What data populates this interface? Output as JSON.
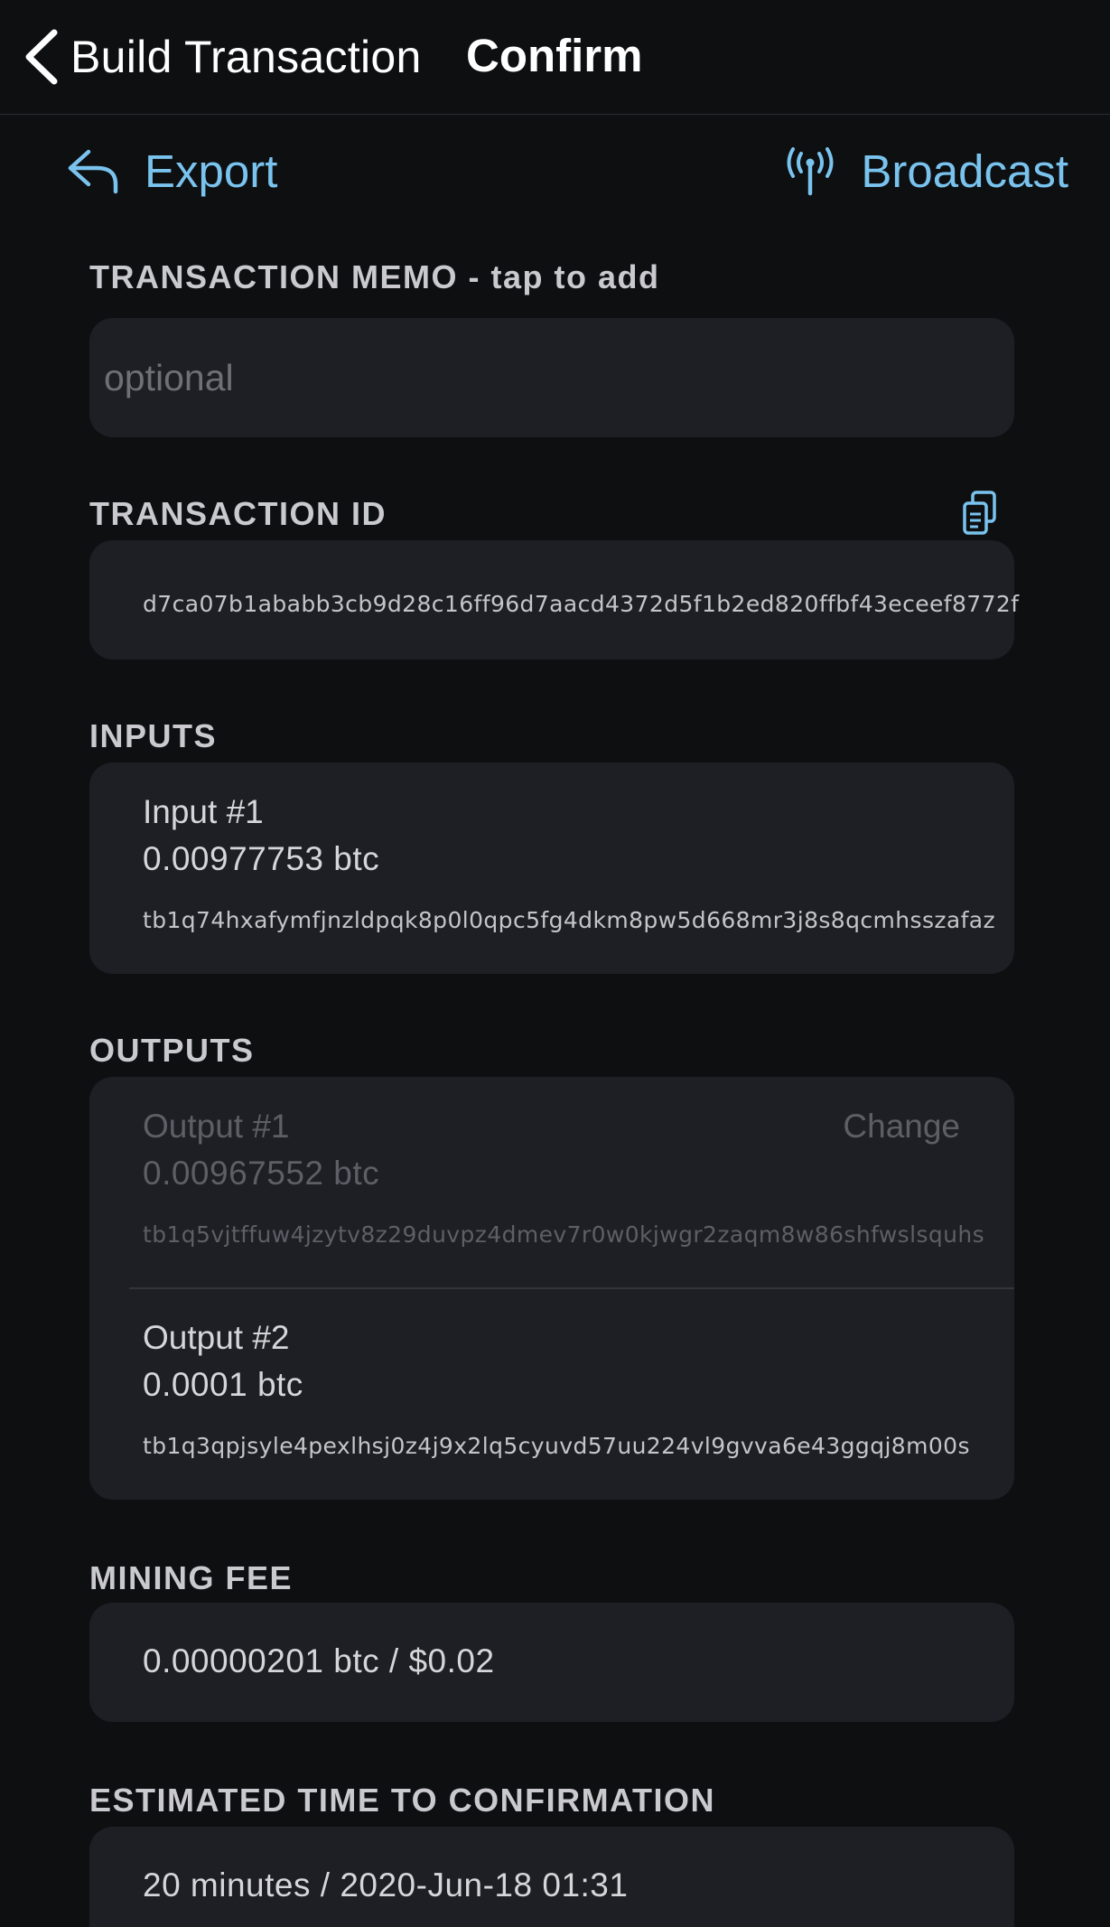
{
  "nav": {
    "back_label": "Build Transaction",
    "title": "Confirm"
  },
  "toolbar": {
    "export_label": "Export",
    "export_icon": "reply-arrow-icon",
    "broadcast_label": "Broadcast",
    "broadcast_icon": "antenna-icon"
  },
  "memo": {
    "label": "TRANSACTION MEMO - tap to add",
    "placeholder": "optional",
    "value": ""
  },
  "transaction_id": {
    "label": "TRANSACTION ID",
    "value": "d7ca07b1ababb3cb9d28c16ff96d7aacd4372d5f1b2ed820ffbf43eceef8772f",
    "copy_icon": "copy-icon"
  },
  "inputs": {
    "label": "INPUTS",
    "items": [
      {
        "title": "Input #1",
        "amount": "0.00977753 btc",
        "address": "tb1q74hxafymfjnzldpqk8p0l0qpc5fg4dkm8pw5d668mr3j8s8qcmhsszafaz"
      }
    ]
  },
  "outputs": {
    "label": "OUTPUTS",
    "items": [
      {
        "title": "Output #1",
        "tag": "Change",
        "amount": "0.00967552 btc",
        "address": "tb1q5vjtffuw4jzytv8z29duvpz4dmev7r0w0kjwgr2zaqm8w86shfwslsquhs"
      },
      {
        "title": "Output #2",
        "amount": "0.0001 btc",
        "address": "tb1q3qpjsyle4pexlhsj0z4j9x2lq5cyuvd57uu224vl9gvva6e43ggqj8m00s"
      }
    ]
  },
  "mining_fee": {
    "label": "MINING FEE",
    "value": "0.00000201 btc / $0.02"
  },
  "eta": {
    "label": "ESTIMATED TIME TO CONFIRMATION",
    "value": "20 minutes / 2020-Jun-18 01:31"
  },
  "colors": {
    "background": "#0e0f11",
    "card": "#1e1f24",
    "accent": "#79c3ee",
    "text": "#d5d5da",
    "dim_text": "#5e5f66"
  }
}
